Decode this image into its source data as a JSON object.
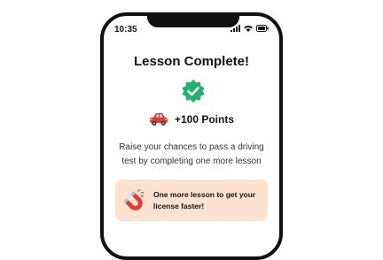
{
  "status_bar": {
    "time": "10:35",
    "icons": [
      "signal-icon",
      "wifi-icon",
      "battery-icon"
    ]
  },
  "screen": {
    "title": "Lesson Complete!",
    "badge_icon": "check-badge-icon",
    "points_icon": "car-icon",
    "points_text": "+100 Points",
    "description": "Raise your chances to pass a driving test by completing one more lesson",
    "callout": {
      "icon": "magnet-icon",
      "text": "One more lesson to get your license faster!"
    }
  },
  "colors": {
    "accent_green": "#22b26a",
    "callout_bg": "#fde3cf",
    "magnet_red": "#e53935"
  }
}
